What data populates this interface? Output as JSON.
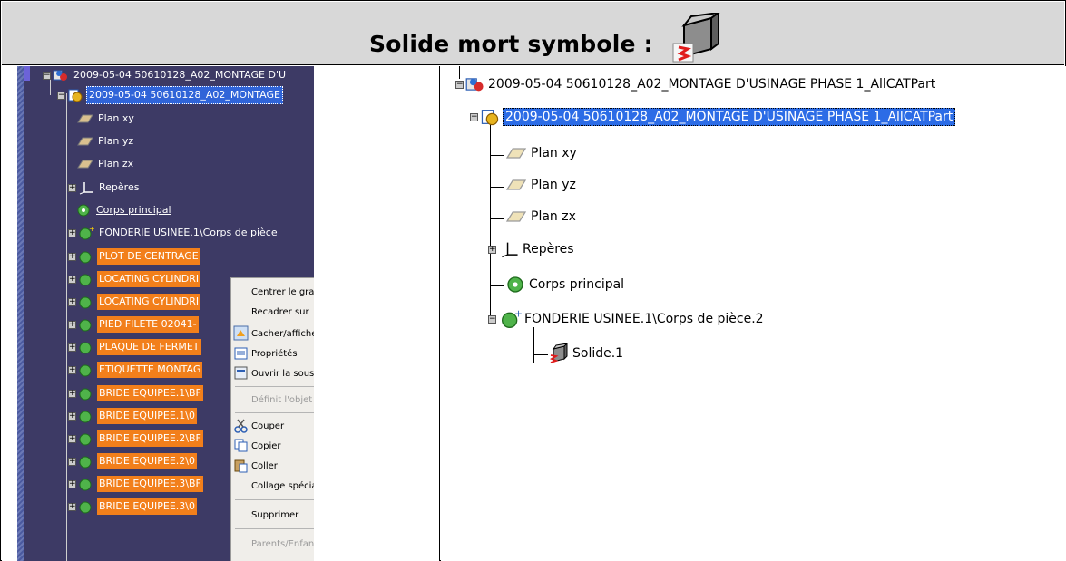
{
  "header": {
    "title": "Solide mort symbole :",
    "icon": "dead-solid-icon"
  },
  "left_tree": {
    "root": "2009-05-04 50610128_A02_MONTAGE D'U",
    "part": "2009-05-04 50610128_A02_MONTAGE",
    "items": [
      {
        "label": "Plan xy"
      },
      {
        "label": "Plan yz"
      },
      {
        "label": "Plan zx"
      },
      {
        "label": "Repères"
      },
      {
        "label": "Corps principal"
      },
      {
        "label": "FONDERIE USINEE.1\\Corps de pièce"
      },
      {
        "label": "PLOT DE CENTRAGE"
      },
      {
        "label": "LOCATING CYLINDRI"
      },
      {
        "label": "LOCATING CYLINDRI"
      },
      {
        "label": "PIED FILETE 02041-"
      },
      {
        "label": "PLAQUE DE FERMET"
      },
      {
        "label": "ETIQUETTE MONTAG"
      },
      {
        "label": "BRIDE EQUIPEE.1\\BF"
      },
      {
        "label": "BRIDE EQUIPEE.1\\0"
      },
      {
        "label": "BRIDE EQUIPEE.2\\BF"
      },
      {
        "label": "BRIDE EQUIPEE.2\\0"
      },
      {
        "label": "BRIDE EQUIPEE.3\\BF"
      },
      {
        "label": "BRIDE EQUIPEE.3\\0"
      }
    ]
  },
  "context_menu": {
    "items": [
      {
        "label": "Centrer le grap",
        "disabled": false
      },
      {
        "label": "Recadrer sur",
        "disabled": false
      },
      {
        "label": "Cacher/affiche",
        "disabled": false
      },
      {
        "label": "Propriétés",
        "disabled": false
      },
      {
        "label": "Ouvrir la sous-",
        "disabled": false
      },
      {
        "label": "Définit l'objet c",
        "disabled": true
      },
      {
        "label": "Couper",
        "disabled": false
      },
      {
        "label": "Copier",
        "disabled": false
      },
      {
        "label": "Coller",
        "disabled": false
      },
      {
        "label": "Collage spécial",
        "disabled": false
      },
      {
        "label": "Supprimer",
        "disabled": false
      },
      {
        "label": "Parents/Enfan",
        "disabled": true
      }
    ]
  },
  "right_tree": {
    "root": "2009-05-04 50610128_A02_MONTAGE D'USINAGE PHASE 1_AllCATPart",
    "part": "2009-05-04 50610128_A02_MONTAGE D'USINAGE PHASE 1_AllCATPart",
    "items": [
      {
        "label": "Plan xy"
      },
      {
        "label": "Plan yz"
      },
      {
        "label": "Plan zx"
      },
      {
        "label": "Repères"
      },
      {
        "label": "Corps principal"
      },
      {
        "label": "FONDERIE USINEE.1\\Corps de pièce.2"
      },
      {
        "label": "Solide.1"
      }
    ]
  },
  "colors": {
    "left_bg": "#3d3a65",
    "selection": "#3064d8",
    "orange": "#f27f1b"
  }
}
